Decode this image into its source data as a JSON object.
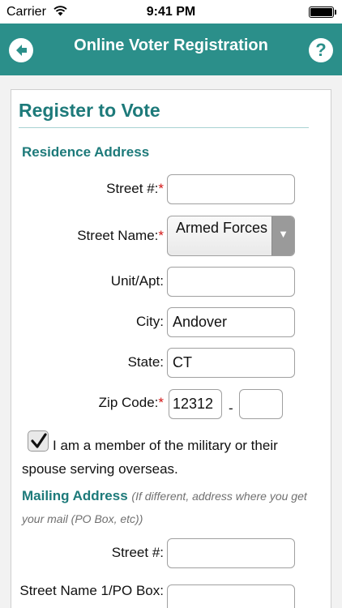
{
  "status_bar": {
    "carrier": "Carrier",
    "time": "9:41 PM"
  },
  "nav": {
    "title": "Online Voter Registration",
    "help_label": "?"
  },
  "form": {
    "title": "Register to Vote",
    "residence": {
      "heading": "Residence Address",
      "street_num_label": "Street #:",
      "street_num_value": "",
      "street_name_label": "Street Name:",
      "street_name_value": "Armed Forces",
      "unit_label": "Unit/Apt:",
      "unit_value": "",
      "city_label": "City:",
      "city_value": "Andover",
      "state_label": "State:",
      "state_value": "CT",
      "zip_label": "Zip Code:",
      "zip_value": "12312",
      "zip_separator": "-",
      "zip_ext_value": "",
      "required_mark": "*"
    },
    "military": {
      "checked": true,
      "label": "I am a member of the military or their spouse serving overseas."
    },
    "mailing": {
      "heading": "Mailing Address",
      "note": "(If different, address where you get your mail (PO Box, etc))",
      "street_num_label": "Street #:",
      "street_num_value": "",
      "street_name_label": "Street Name 1/PO Box:",
      "street_name_value": ""
    }
  }
}
